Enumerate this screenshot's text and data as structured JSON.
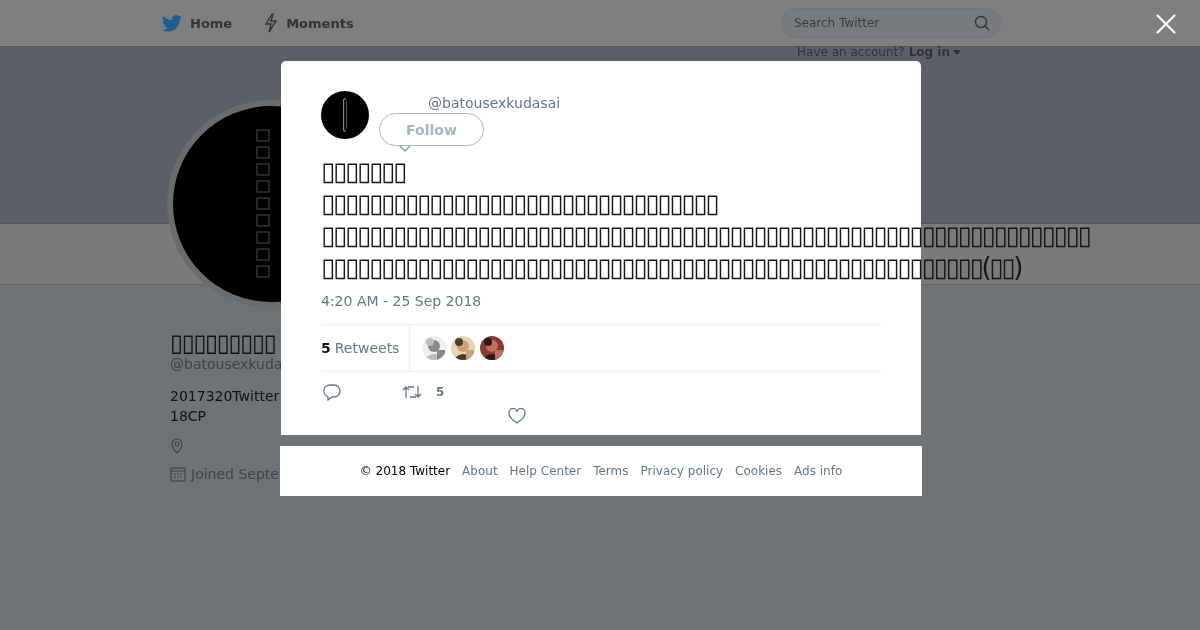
{
  "nav": {
    "items": [
      {
        "label": "Home",
        "kind": "bird"
      },
      {
        "label": "Moments",
        "kind": "bolt"
      }
    ]
  },
  "search": {
    "placeholder": "Search Twitter"
  },
  "account_prompt": {
    "text": "Have an account?",
    "link": "Log in"
  },
  "profile": {
    "name": "▯▯▯▯▯▯▯▯▯",
    "handle": "@batousexkuda",
    "bio": [
      "2017320Twitter",
      "18CP"
    ],
    "joined": "Joined Septe"
  },
  "tweet": {
    "handle": "@batousexkudasai",
    "follow_label": "Follow",
    "lines": [
      "▯▯▯▯▯▯▯",
      "▯▯▯▯▯▯▯▯▯▯▯▯▯▯▯▯▯▯▯▯▯▯▯▯▯▯▯▯▯▯▯▯▯",
      "▯▯▯▯▯▯▯▯▯▯▯▯▯▯▯▯▯▯▯▯▯▯▯▯▯▯▯▯▯▯▯▯▯▯▯▯▯▯▯▯▯▯▯▯▯▯▯▯▯▯▯▯▯▯▯▯▯▯▯▯▯▯▯▯",
      "▯▯▯▯▯▯▯▯▯▯▯▯▯▯▯▯▯▯▯▯▯▯▯▯▯▯▯▯▯▯▯▯▯▯▯▯▯▯▯▯▯▯▯▯▯▯▯▯▯▯▯▯▯▯▯(▯▯)"
    ],
    "timestamp": "4:20 AM - 25 Sep 2018",
    "retweet_count": "5",
    "retweet_label": "Retweets",
    "action_retweet_count": "5"
  },
  "footer": {
    "links": [
      "© 2018 Twitter",
      "About",
      "Help Center",
      "Terms",
      "Privacy policy",
      "Cookies",
      "Ads info"
    ]
  }
}
